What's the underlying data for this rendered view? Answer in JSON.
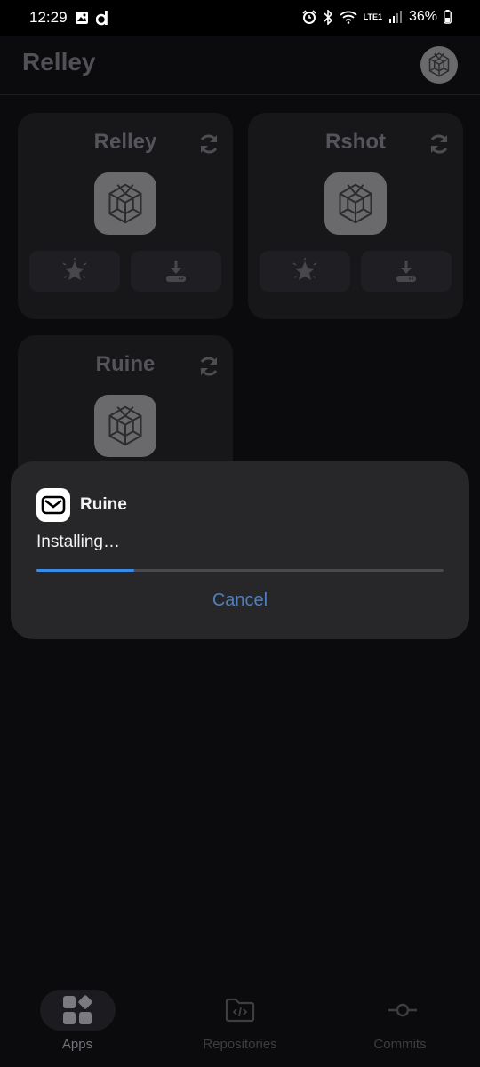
{
  "status_bar": {
    "time": "12:29",
    "battery": "36%",
    "network": "LTE1"
  },
  "app_bar": {
    "title": "Relley"
  },
  "cards": [
    {
      "name": "Relley"
    },
    {
      "name": "Rshot"
    },
    {
      "name": "Ruine"
    }
  ],
  "dialog": {
    "app_name": "Ruine",
    "status": "Installing…",
    "progress": 0.24,
    "cancel_label": "Cancel",
    "accent": "#3a8be6"
  },
  "bottom_nav": {
    "items": [
      {
        "label": "Apps",
        "icon": "apps-grid-icon",
        "active": true
      },
      {
        "label": "Repositories",
        "icon": "folder-code-icon",
        "active": false
      },
      {
        "label": "Commits",
        "icon": "commit-icon",
        "active": false
      }
    ]
  }
}
